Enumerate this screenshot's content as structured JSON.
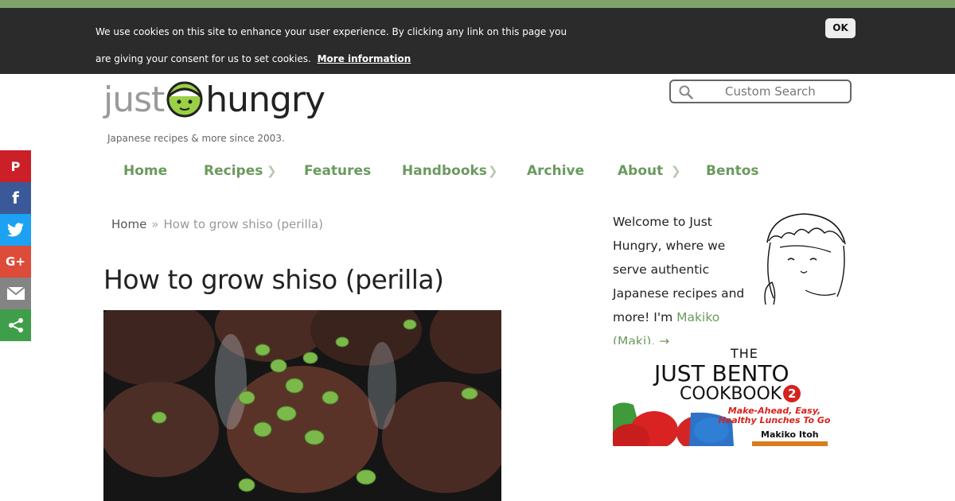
{
  "cookie_banner": {
    "text": "We use cookies on this site to enhance your user experience. By clicking any link on this page you are giving your consent for us to set cookies.",
    "more_label": "More information",
    "ok_label": "OK"
  },
  "site": {
    "logo_just": "just",
    "logo_hungry": "hungry",
    "tagline": "Japanese recipes & more since 2003.",
    "search_placeholder": "Custom Search"
  },
  "nav": {
    "items": [
      {
        "label": "Home"
      },
      {
        "label": "Recipes"
      },
      {
        "label": "Features"
      },
      {
        "label": "Handbooks"
      },
      {
        "label": "Archive"
      },
      {
        "label": "About"
      },
      {
        "label": "Bentos"
      }
    ]
  },
  "breadcrumb": {
    "home": "Home",
    "separator": "»",
    "current": "How to grow shiso (perilla)"
  },
  "article": {
    "title": "How to grow shiso (perilla)"
  },
  "share": {
    "pinterest_glyph": "P",
    "facebook_glyph": "f",
    "googleplus_glyph": "G+"
  },
  "sidebar": {
    "welcome_text": "Welcome to Just Hungry, where we serve authentic Japanese recipes and more! I'm",
    "welcome_link": "Makiko (Maki). →",
    "book": {
      "the": "THE",
      "title_line1": "JUST BENTO",
      "title_line2": "COOKBOOK",
      "number": "2",
      "subtitle": "Make-Ahead, Easy, Healthy Lunches To Go",
      "author": "Makiko Itoh"
    }
  },
  "colors": {
    "accent_green": "#6a9a5e",
    "cookie_bar": "#2b2b2b",
    "pinterest": "#cb2027",
    "facebook": "#3b5998",
    "twitter": "#1da1f2",
    "googleplus": "#dd4b39",
    "email": "#848484",
    "more": "#3f9e4a"
  }
}
